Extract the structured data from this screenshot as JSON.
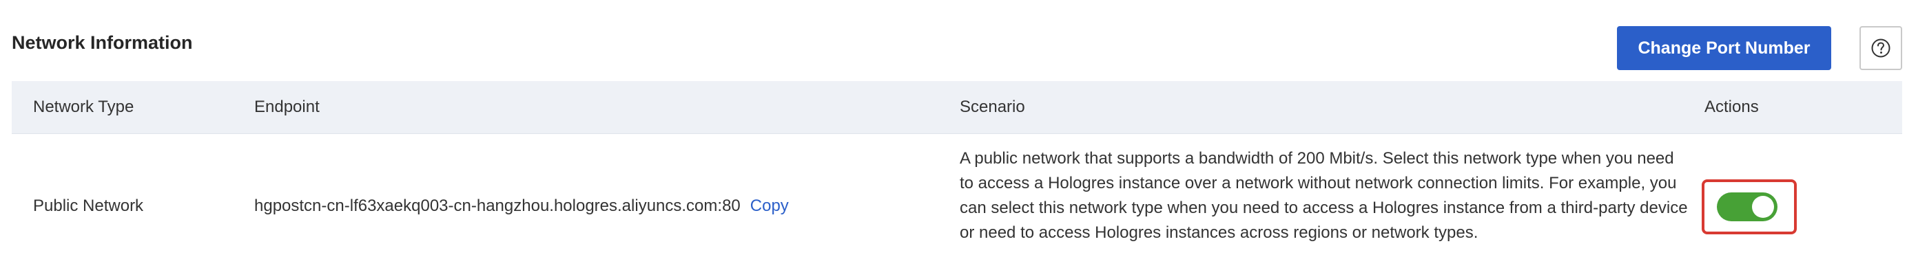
{
  "section": {
    "title": "Network Information"
  },
  "toolbar": {
    "change_port_label": "Change Port Number",
    "help_icon": "question-circle-icon"
  },
  "table": {
    "columns": [
      "Network Type",
      "Endpoint",
      "Scenario",
      "Actions"
    ],
    "rows": [
      {
        "network_type": "Public Network",
        "endpoint": "hgpostcn-cn-lf63xaekq003-cn-hangzhou.hologres.aliyuncs.com:80",
        "copy_label": "Copy",
        "scenario": "A public network that supports a bandwidth of 200 Mbit/s. Select this network type when you need to access a Hologres instance over a network without network connection limits. For example, you can select this network type when you need to access a Hologres instance from a third-party device or need to access Hologres instances across regions or network types.",
        "action_enabled": true
      }
    ]
  },
  "colors": {
    "primary": "#2b5fc9",
    "toggle_on": "#47a136",
    "highlight": "#d83a32",
    "header_bg": "#eef1f6"
  }
}
